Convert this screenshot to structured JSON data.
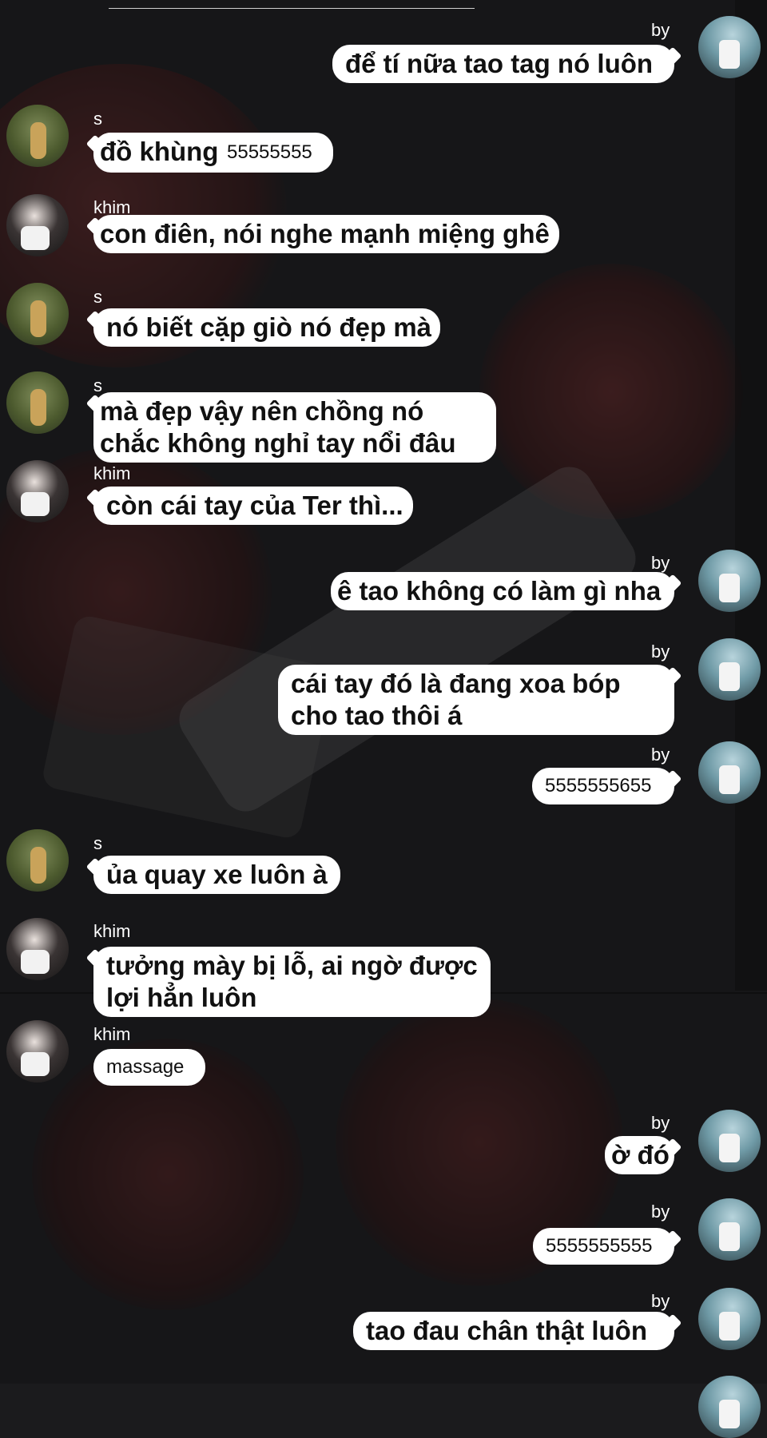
{
  "messages": [
    {
      "sender": "by",
      "text": "để tí nữa tao tag nó luôn"
    },
    {
      "sender": "s",
      "text": "đồ khùng",
      "extra": "55555555"
    },
    {
      "sender": "khim",
      "text": "con điên, nói nghe mạnh miệng ghê"
    },
    {
      "sender": "s",
      "text": "nó biết cặp giò nó đẹp mà"
    },
    {
      "sender": "s",
      "text": "mà đẹp vậy nên chồng nó chắc không nghỉ tay nổi đâu"
    },
    {
      "sender": "khim",
      "text": "còn cái tay của Ter thì..."
    },
    {
      "sender": "by",
      "text": "ê tao không có làm gì nha"
    },
    {
      "sender": "by",
      "text": "cái tay đó là đang xoa bóp cho tao thôi á"
    },
    {
      "sender": "by",
      "text": "5555555655"
    },
    {
      "sender": "s",
      "text": "ủa quay xe luôn à"
    },
    {
      "sender": "khim",
      "text": "tưởng mày bị lỗ, ai ngờ được lợi hẳn luôn"
    },
    {
      "sender": "khim",
      "text": "massage"
    },
    {
      "sender": "by",
      "text": "ờ đó"
    },
    {
      "sender": "by",
      "text": "5555555555"
    },
    {
      "sender": "by",
      "text": "tao đau chân thật luôn"
    }
  ],
  "colors": {
    "background": "#1b1b1d",
    "bubble": "#ffffff",
    "bubble_text": "#111111",
    "name_text": "#ffffff"
  },
  "icons": {
    "s": "avatar-s",
    "khim": "avatar-khim",
    "by": "avatar-by"
  }
}
